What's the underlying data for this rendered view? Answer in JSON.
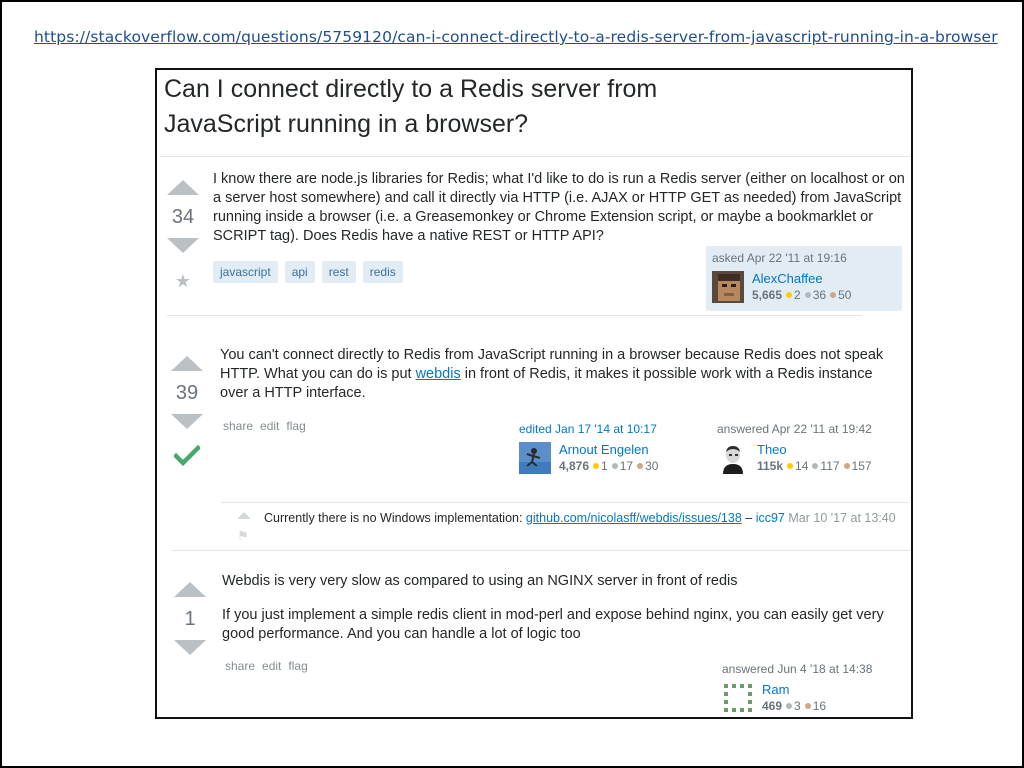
{
  "url": "https://stackoverflow.com/questions/5759120/can-i-connect-directly-to-a-redis-server-from-javascript-running-in-a-browser",
  "question": {
    "title_line1": "Can I connect directly to a Redis server from",
    "title_line2": "JavaScript running in a browser?",
    "votes": "34",
    "body": "I know there are node.js libraries for Redis; what I'd like to do is run a Redis server (either on localhost or on a server host somewhere) and call it directly via HTTP (i.e. AJAX or HTTP GET as needed) from JavaScript running inside a browser (i.e. a Greasemonkey or Chrome Extension script, or maybe a bookmarklet or SCRIPT tag). Does Redis have a native REST or HTTP API?",
    "tags": [
      "javascript",
      "api",
      "rest",
      "redis"
    ],
    "asked": "asked Apr 22 '11 at 19:16",
    "user": {
      "name": "AlexChaffee",
      "rep": "5,665",
      "gold": "2",
      "silver": "36",
      "bronze": "50"
    }
  },
  "answer1": {
    "votes": "39",
    "body_before": "You can't connect directly to Redis from JavaScript running in a browser because Redis does not speak HTTP. What you can do is put ",
    "link": "webdis",
    "body_after": " in front of Redis, it makes it possible work with a Redis instance over a HTTP interface.",
    "menu": [
      "share",
      "edit",
      "flag"
    ],
    "edited": "edited Jan 17 '14 at 10:17",
    "editor": {
      "name": "Arnout Engelen",
      "rep": "4,876",
      "gold": "1",
      "silver": "17",
      "bronze": "30"
    },
    "answered": "answered Apr 22 '11 at 19:42",
    "user": {
      "name": "Theo",
      "rep": "115k",
      "gold": "14",
      "silver": "117",
      "bronze": "157"
    },
    "comment": {
      "text": "Currently there is no Windows implementation: ",
      "link": "github.com/nicolasff/webdis/issues/138",
      "dash": " – ",
      "user": "icc97",
      "date": "Mar 10 '17 at 13:40"
    }
  },
  "answer2": {
    "votes": "1",
    "para1": "Webdis is very very slow as compared to using an NGINX server in front of redis",
    "para2": "If you just implement a simple redis client in mod-perl and expose behind nginx, you can easily get very good performance. And you can handle a lot of logic too",
    "menu": [
      "share",
      "edit",
      "flag"
    ],
    "answered": "answered Jun 4 '18 at 14:38",
    "user": {
      "name": "Ram",
      "rep": "469",
      "silver": "3",
      "bronze": "16"
    }
  },
  "colors": {
    "link": "#0077cc",
    "accepted": "#48a868",
    "tag_bg": "#e1ecf4",
    "tag_fg": "#39739d",
    "vote_arrow": "#bbc0c4"
  }
}
